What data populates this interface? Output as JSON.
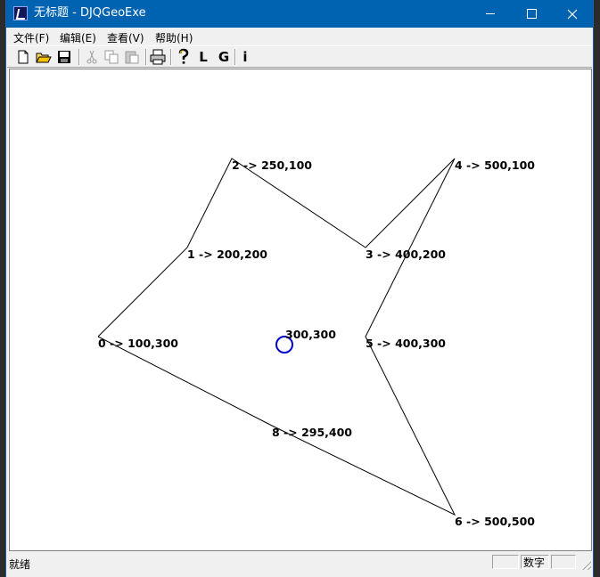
{
  "window": {
    "title": "无标题 - DJQGeoExe"
  },
  "menu": [
    "文件(F)",
    "编辑(E)",
    "查看(V)",
    "帮助(H)"
  ],
  "toolbar": {
    "buttons": [
      "new-icon",
      "open-icon",
      "save-icon",
      "cut-icon",
      "copy-icon",
      "paste-icon",
      "print-icon",
      "help-icon"
    ],
    "letters": [
      "L",
      "G",
      "i"
    ]
  },
  "canvas": {
    "points": [
      {
        "label": "0 -> 100,300"
      },
      {
        "label": "1 -> 200,200"
      },
      {
        "label": "2 -> 250,100"
      },
      {
        "label": "3 -> 400,200"
      },
      {
        "label": "4 -> 500,100"
      },
      {
        "label": "5 -> 400,300"
      },
      {
        "label": "6 -> 500,500"
      },
      {
        "label": "8 -> 295,400"
      }
    ],
    "center_label": "300,300",
    "marker_color": "#0000cc"
  },
  "status": {
    "text": "就绪",
    "pane_num": "数字"
  }
}
